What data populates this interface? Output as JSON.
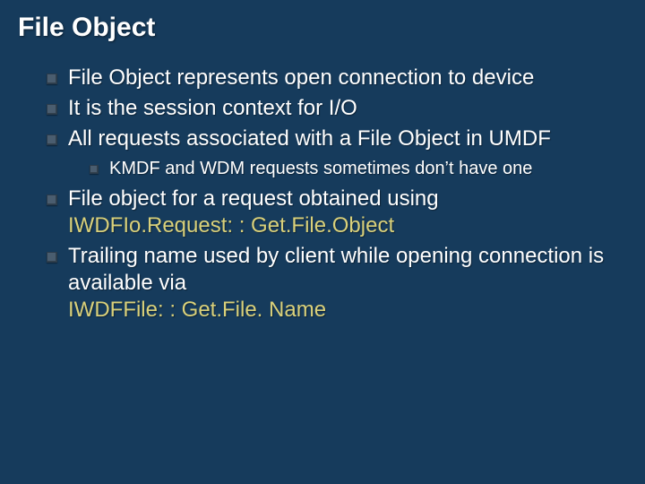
{
  "title": "File Object",
  "bullets": {
    "b1": "File Object represents open connection to device",
    "b2": "It is the session context for I/O",
    "b3": "All requests associated with a File Object in UMDF",
    "b3_sub1": "KMDF and WDM requests sometimes don’t have one",
    "b4_text": "File object for a request obtained using ",
    "b4_code": "IWDFIo.Request: : Get.File.Object",
    "b5_text": "Trailing name used by client while opening connection is available via ",
    "b5_code": "IWDFFile: : Get.File. Name"
  }
}
